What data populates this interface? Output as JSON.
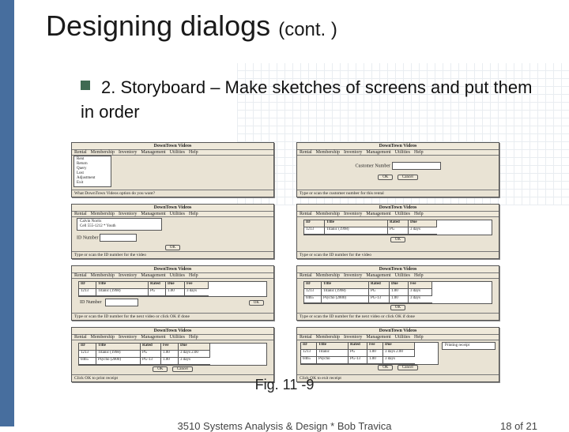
{
  "title": {
    "main": "Designing dialogs",
    "cont": "(cont. )"
  },
  "bullet": "2. Storyboard – Make sketches of screens and put them in order",
  "figure_caption": "Fig. 11 -9",
  "footer": {
    "course": "3510 Systems Analysis & Design * Bob Travica",
    "pager": "18 of 21"
  },
  "storyboard": {
    "app_title": "DownTown Videos",
    "menubar": [
      "Rental",
      "Membership",
      "Inventory",
      "Management",
      "Utilities",
      "Help"
    ],
    "s1": {
      "menu_items": [
        "Rent",
        "Return",
        "Query",
        "Lost",
        "Adjustment",
        "Exit"
      ],
      "status": "What DownTown Videos option do you want?"
    },
    "s2": {
      "label": "Customer Number",
      "buttons": [
        "OK",
        "Cancel"
      ],
      "status": "Type or scan the customer number for this rental"
    },
    "s3": {
      "panel_lines": [
        "Calvin Norris",
        "Cell 555-1212 * Youth"
      ],
      "field_label": "ID Number",
      "buttons": [
        "OK"
      ],
      "status": "Type or scan the ID number for the video"
    },
    "s4": {
      "table": {
        "headers": [
          "ID",
          "Title",
          "Rated",
          "Due"
        ],
        "row": [
          "1213",
          "Titanic (1998)",
          "PG",
          "3 days"
        ]
      },
      "buttons": [
        "OK"
      ],
      "status": "Type or scan the ID number for the video"
    },
    "s5": {
      "table": {
        "headers": [
          "ID",
          "Title",
          "Rated",
          "Due",
          "Fee"
        ],
        "row": [
          "1213",
          "Titanic (1998)",
          "PG",
          "1.00",
          "3 days"
        ]
      },
      "field_label": "ID Number",
      "buttons": [
        "OK"
      ],
      "status": "Type or scan the ID number for the next video or click OK if done"
    },
    "s6": {
      "table": {
        "headers": [
          "ID",
          "Title",
          "Rated",
          "Due",
          "Fee"
        ],
        "rows": [
          [
            "1213",
            "Titanic (1998)",
            "PG",
            "1.00",
            "3 days"
          ],
          [
            "0465",
            "Psycho (2000)",
            "PG-13",
            "1.00",
            "3 days"
          ]
        ]
      },
      "buttons": [
        "OK"
      ],
      "status": "Type or scan the ID number for the next video or click OK if done"
    },
    "s7": {
      "table": {
        "headers": [
          "ID",
          "Title",
          "Rated",
          "Fee",
          "Due"
        ],
        "rows": [
          [
            "1213",
            "Titanic (1998)",
            "PG",
            "1.00",
            "3 days 2.00"
          ],
          [
            "0465",
            "Psycho (2000)",
            "PG-13",
            "1.00",
            "3 days"
          ]
        ]
      },
      "buttons": [
        "OK",
        "Cancel"
      ],
      "status": "Click OK to print receipt"
    },
    "s8": {
      "table": {
        "headers": [
          "ID",
          "Title",
          "Rated",
          "Fee",
          "Due"
        ],
        "rows": [
          [
            "1213",
            "Titanic",
            "PG",
            "1.00",
            "3 days 2.00"
          ],
          [
            "0465",
            "Psycho",
            "PG-13",
            "1.00",
            "3 days"
          ]
        ]
      },
      "secondary_label": "Printing receipt",
      "buttons": [
        "OK",
        "Cancel"
      ],
      "status": "Click OK to exit receipt"
    }
  }
}
